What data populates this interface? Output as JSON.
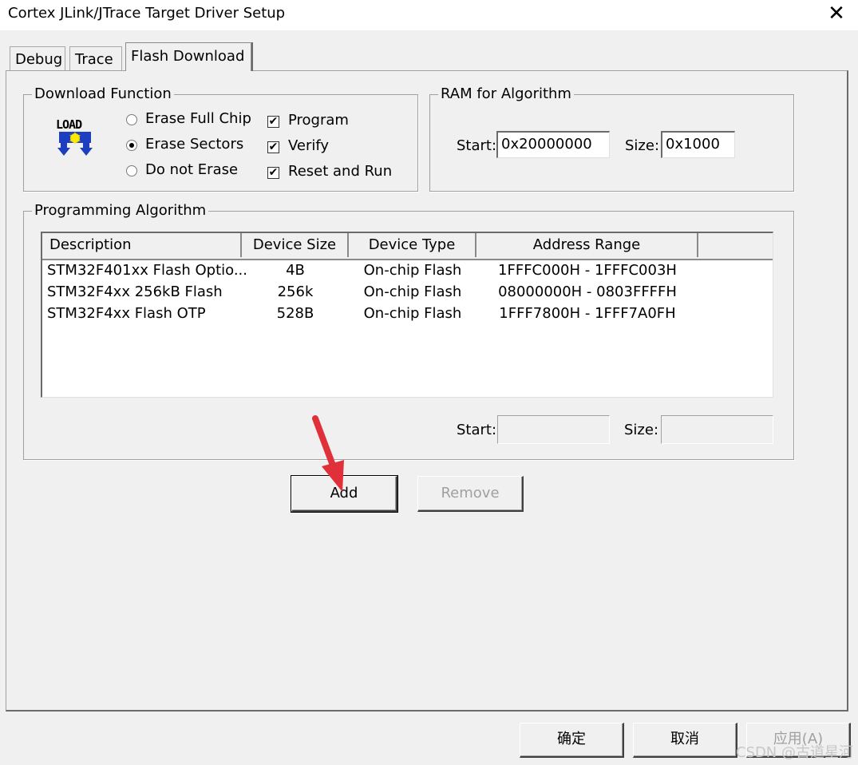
{
  "window": {
    "title": "Cortex JLink/JTrace Target Driver Setup",
    "close_glyph": "✕"
  },
  "tabs": [
    {
      "label": "Debug",
      "active": false
    },
    {
      "label": "Trace",
      "active": false
    },
    {
      "label": "Flash Download",
      "active": true
    }
  ],
  "download_function": {
    "title": "Download Function",
    "icon": "load-icon",
    "icon_text": "LOAD",
    "radios": [
      {
        "label": "Erase Full Chip",
        "selected": false
      },
      {
        "label": "Erase Sectors",
        "selected": true
      },
      {
        "label": "Do not Erase",
        "selected": false
      }
    ],
    "checks": [
      {
        "label": "Program",
        "checked": true
      },
      {
        "label": "Verify",
        "checked": true
      },
      {
        "label": "Reset and Run",
        "checked": true
      }
    ]
  },
  "ram": {
    "title": "RAM for Algorithm",
    "start_label": "Start:",
    "start_value": "0x20000000",
    "size_label": "Size:",
    "size_value": "0x1000"
  },
  "algorithm": {
    "title": "Programming Algorithm",
    "columns": [
      "Description",
      "Device Size",
      "Device Type",
      "Address Range"
    ],
    "rows": [
      [
        "STM32F401xx Flash Optio...",
        "4B",
        "On-chip Flash",
        "1FFFC000H - 1FFFC003H"
      ],
      [
        "STM32F4xx 256kB Flash",
        "256k",
        "On-chip Flash",
        "08000000H - 0803FFFFH"
      ],
      [
        "STM32F4xx Flash OTP",
        "528B",
        "On-chip Flash",
        "1FFF7800H - 1FFF7A0FH"
      ]
    ],
    "start_label": "Start:",
    "start_value": "",
    "size_label": "Size:",
    "size_value": ""
  },
  "buttons": {
    "add": "Add",
    "remove": "Remove",
    "ok": "确定",
    "cancel": "取消",
    "apply": "应用(A)"
  },
  "annotation": {
    "arrow_color": "#e0303a"
  },
  "watermark": "CSDN @古道星河"
}
